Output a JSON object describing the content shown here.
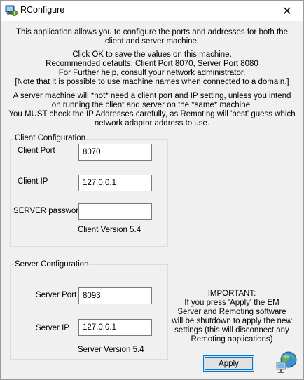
{
  "window": {
    "title": "RConfigure",
    "close_glyph": "✕",
    "app_icon": "rconfigure-app-icon"
  },
  "intro": {
    "line1": "This application allows you to configure the ports and addresses for both the client and server machine.",
    "line2": "Click OK to save the values on this machine.\nRecommended defaults: Client Port 8070, Server Port 8080\nFor Further help, consult your  network administrator.\n[Note that it is possible to use machine names when connected to a domain.]",
    "line3": "A server machine will *not* need a client port and IP setting, unless you intend on running the client and server on the *same* machine.\nYou MUST check the IP Addresses carefully, as Remoting will 'best' guess which network adaptor address to use."
  },
  "client": {
    "group_label": "Client Configuration",
    "port_label": "Client Port",
    "port_value": "8070",
    "ip_label": "Client IP",
    "ip_value": "127.0.0.1",
    "password_label": "SERVER password",
    "password_value": "",
    "version": "Client Version 5.4"
  },
  "server": {
    "group_label": "Server Configuration",
    "port_label": "Server Port",
    "port_value": "8093",
    "ip_label": "Server IP",
    "ip_value": "127.0.0.1",
    "version": "Server Version 5.4"
  },
  "important": {
    "text": "IMPORTANT:\nIf you press 'Apply' the EM Server and Remoting software will be shutdown to apply the new settings (this will disconnect any Remoting applications)"
  },
  "actions": {
    "apply_label": "Apply"
  },
  "colors": {
    "accent": "#0078d7",
    "window_bg": "#f0f0f0"
  }
}
